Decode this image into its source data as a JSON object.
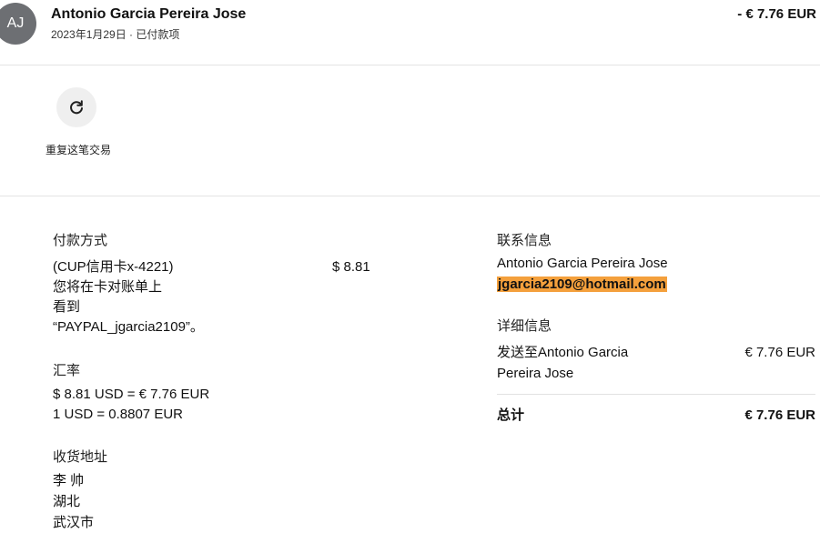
{
  "header": {
    "avatar_initials": "AJ",
    "name": "Antonio Garcia Pereira Jose",
    "date_status": "2023年1月29日 · 已付款项",
    "amount": "- € 7.76 EUR"
  },
  "actions": {
    "repeat_label": "重复这笔交易"
  },
  "payment": {
    "title": "付款方式",
    "method": "(CUP信用卡x-4221)",
    "amount": "$ 8.81",
    "note_line1": "您将在卡对账单上",
    "note_line2": "看到",
    "note_line3": "“PAYPAL_jgarcia2109”。"
  },
  "exchange": {
    "title": "汇率",
    "line1": "$ 8.81 USD = € 7.76 EUR",
    "line2": "1 USD = 0.8807 EUR"
  },
  "shipping": {
    "title": "收货地址",
    "line1": "李 帅",
    "line2": "湖北",
    "line3": "武汉市"
  },
  "contact": {
    "title": "联系信息",
    "name": "Antonio Garcia Pereira Jose",
    "email": "jgarcia2109@hotmail.com"
  },
  "details": {
    "title": "详细信息",
    "sent_to_line1": "发送至Antonio Garcia",
    "sent_to_line2": "Pereira Jose",
    "sent_amount": "€ 7.76 EUR",
    "total_label": "总计",
    "total_amount": "€ 7.76 EUR"
  },
  "colors": {
    "avatar_bg": "#6d6f73",
    "email_highlight": "#f4a03c"
  }
}
